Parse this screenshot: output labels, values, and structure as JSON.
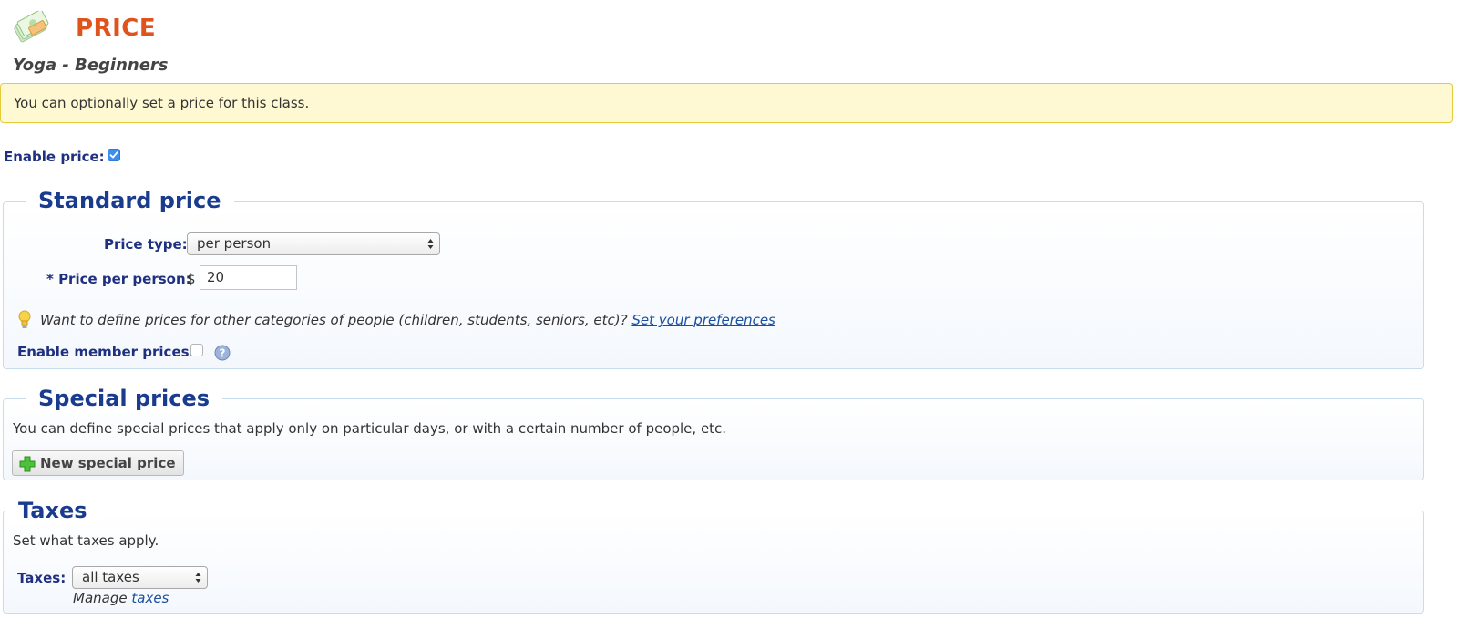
{
  "header": {
    "title": "PRICE",
    "class_name": "Yoga - Beginners"
  },
  "notice": "You can optionally set a price for this class.",
  "enable_price": {
    "label": "Enable price:",
    "checked": true
  },
  "standard_price": {
    "legend": "Standard price",
    "price_type_label": "Price type:",
    "price_type_value": "per person",
    "price_per_person_label": "* Price per person:",
    "currency_symbol": "$",
    "price_value": "20",
    "hint_text": "Want to define prices for other categories of people (children, students, seniors, etc)?",
    "hint_link": "Set your preferences",
    "member_prices_label": "Enable member prices:",
    "member_prices_checked": false
  },
  "special_prices": {
    "legend": "Special prices",
    "description": "You can define special prices that apply only on particular days, or with a certain number of people, etc.",
    "new_button": "New special price"
  },
  "taxes": {
    "legend": "Taxes",
    "description": "Set what taxes apply.",
    "taxes_label": "Taxes:",
    "taxes_value": "all taxes",
    "manage_prefix": "Manage",
    "manage_link": "taxes"
  },
  "icons": {
    "header": "money-icon",
    "hint": "lightbulb-icon",
    "help": "help-icon",
    "add": "plus-icon"
  },
  "colors": {
    "title": "#e0541c",
    "label": "#1f3080",
    "legend": "#1a3c8f",
    "notice_bg": "#fef9d3",
    "notice_border": "#e6cb3b",
    "link": "#1a4fa0"
  }
}
